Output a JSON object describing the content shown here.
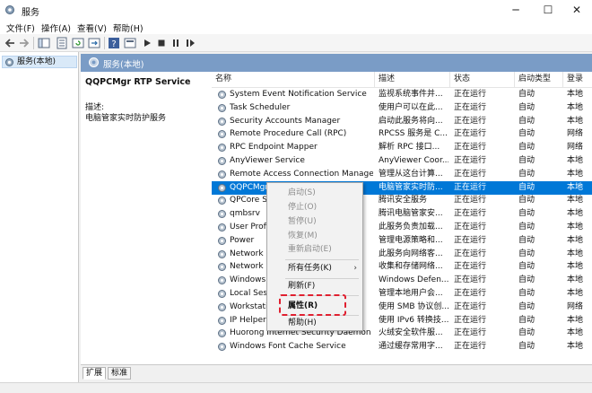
{
  "window": {
    "title": "服务",
    "minimize": "─",
    "maximize": "☐",
    "close": "✕"
  },
  "menu": [
    "文件(F)",
    "操作(A)",
    "查看(V)",
    "帮助(H)"
  ],
  "toolbar_icons": [
    "back-icon",
    "forward-icon",
    "show-tree-icon",
    "properties-icon",
    "refresh-icon",
    "export-icon",
    "help-icon",
    "start-icon",
    "stop-icon",
    "pause-icon",
    "restart-icon"
  ],
  "tree": {
    "item": "服务(本地)"
  },
  "right_header": {
    "label": "服务(本地)"
  },
  "description": {
    "service_name": "QQPCMgr RTP Service",
    "label": "描述:",
    "text": "电脑管家实时防护服务"
  },
  "columns": [
    "名称",
    "描述",
    "状态",
    "启动类型",
    "登录"
  ],
  "rows": [
    {
      "name": "System Event Notification Service",
      "desc": "监视系统事件并...",
      "status": "正在运行",
      "start": "自动",
      "logon": "本地"
    },
    {
      "name": "Task Scheduler",
      "desc": "使用户可以在此...",
      "status": "正在运行",
      "start": "自动",
      "logon": "本地"
    },
    {
      "name": "Security Accounts Manager",
      "desc": "启动此服务将向...",
      "status": "正在运行",
      "start": "自动",
      "logon": "本地"
    },
    {
      "name": "Remote Procedure Call (RPC)",
      "desc": "RPCSS 服务是 C...",
      "status": "正在运行",
      "start": "自动",
      "logon": "网络"
    },
    {
      "name": "RPC Endpoint Mapper",
      "desc": "解析 RPC 接口...",
      "status": "正在运行",
      "start": "自动",
      "logon": "网络"
    },
    {
      "name": "AnyViewer Service",
      "desc": "AnyViewer Coor...",
      "status": "正在运行",
      "start": "自动",
      "logon": "本地"
    },
    {
      "name": "Remote Access Connection Manager",
      "desc": "管理从这台计算...",
      "status": "正在运行",
      "start": "自动",
      "logon": "本地"
    },
    {
      "name": "QQPCMgr RTP Service",
      "desc": "电脑管家实时防...",
      "status": "正在运行",
      "start": "自动",
      "logon": "本地"
    },
    {
      "name": "QPCore Service",
      "desc": "腾讯安全服务",
      "status": "正在运行",
      "start": "自动",
      "logon": "本地"
    },
    {
      "name": "qmbsrv",
      "desc": "腾讯电脑管家安...",
      "status": "正在运行",
      "start": "自动",
      "logon": "本地"
    },
    {
      "name": "User Profile Service",
      "desc": "此服务负责加载...",
      "status": "正在运行",
      "start": "自动",
      "logon": "本地"
    },
    {
      "name": "Power",
      "desc": "管理电源策略和...",
      "status": "正在运行",
      "start": "自动",
      "logon": "本地"
    },
    {
      "name": "Network Store Interface Service",
      "desc": "此服务向网络客...",
      "status": "正在运行",
      "start": "自动",
      "logon": "本地"
    },
    {
      "name": "Network List Service",
      "desc": "收集和存储网络...",
      "status": "正在运行",
      "start": "自动",
      "logon": "本地"
    },
    {
      "name": "Windows Defender Firewall",
      "desc": "Windows Defen...",
      "status": "正在运行",
      "start": "自动",
      "logon": "本地"
    },
    {
      "name": "Local Session Manager",
      "desc": "管理本地用户会...",
      "status": "正在运行",
      "start": "自动",
      "logon": "本地"
    },
    {
      "name": "Workstation",
      "desc": "使用 SMB 协议创...",
      "status": "正在运行",
      "start": "自动",
      "logon": "网络"
    },
    {
      "name": "IP Helper",
      "desc": "使用 IPv6 转换技...",
      "status": "正在运行",
      "start": "自动",
      "logon": "本地"
    },
    {
      "name": "Huorong Internet Security Daemon",
      "desc": "火绒安全软件服...",
      "status": "正在运行",
      "start": "自动",
      "logon": "本地"
    },
    {
      "name": "Windows Font Cache Service",
      "desc": "通过缓存常用字...",
      "status": "正在运行",
      "start": "自动",
      "logon": "本地"
    }
  ],
  "context_menu": {
    "start": "启动(S)",
    "stop": "停止(O)",
    "pause": "暂停(U)",
    "resume": "恢复(M)",
    "restart": "重新启动(E)",
    "all_tasks": "所有任务(K)",
    "refresh": "刷新(F)",
    "properties": "属性(R)",
    "help": "帮助(H)"
  },
  "tabs": [
    "扩展",
    "标准"
  ],
  "colors": {
    "selection": "#0078d7",
    "header_bar": "#7a9cc6",
    "highlight": "#e02030"
  }
}
